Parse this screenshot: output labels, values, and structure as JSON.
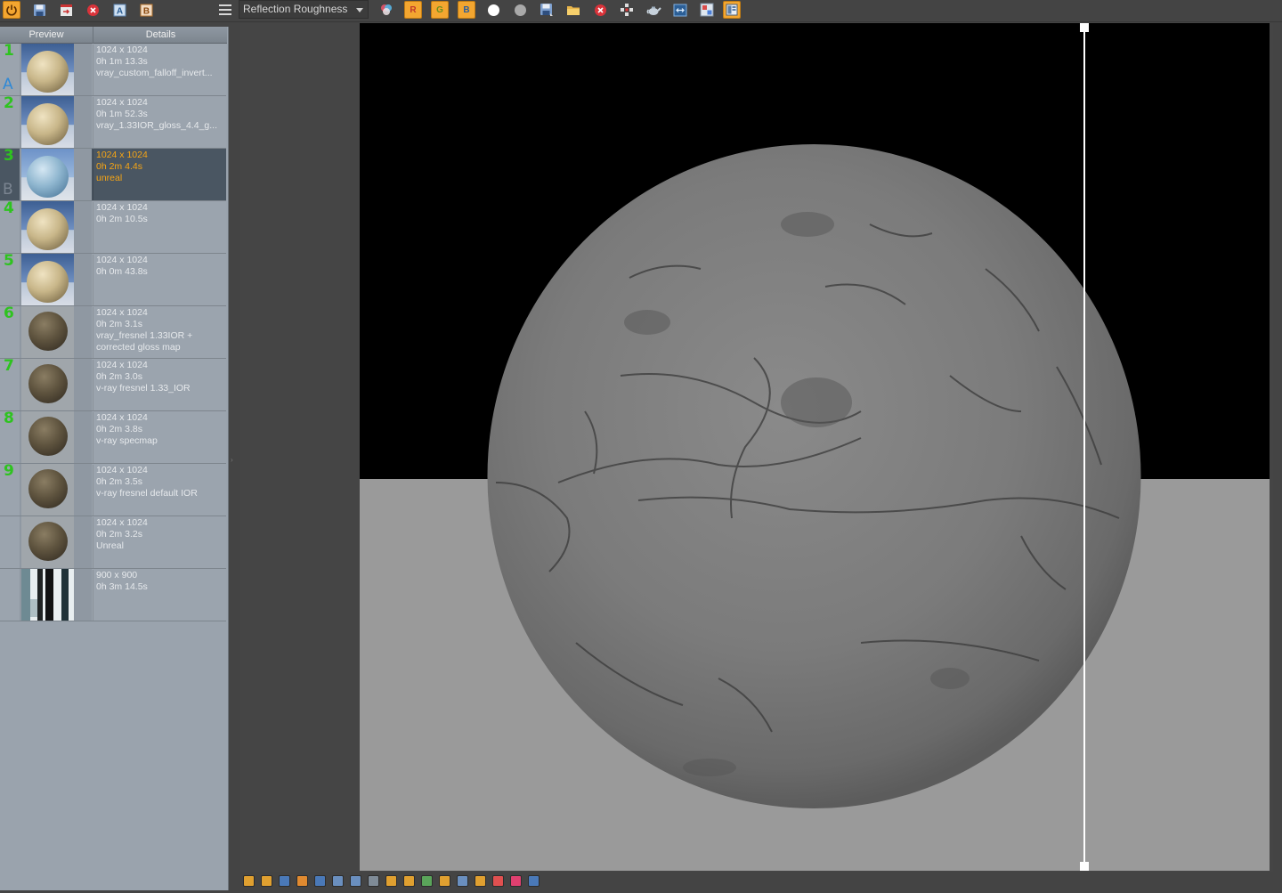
{
  "toolbar": {
    "channel_selected": "Reflection Roughness",
    "buttons": [
      {
        "name": "power-button",
        "icon": "power-icon",
        "color": "#f3a630"
      },
      {
        "name": "save-image-button",
        "icon": "floppy-icon"
      },
      {
        "name": "save-all-button",
        "icon": "save-all-icon"
      },
      {
        "name": "clear-button",
        "icon": "close-circle-icon",
        "color": "#d9333a"
      },
      {
        "name": "set-a-button",
        "icon": "a-letter-icon",
        "label": "A"
      },
      {
        "name": "set-b-button",
        "icon": "b-letter-icon",
        "label": "B"
      },
      {
        "name": "menu-button",
        "icon": "hamburger-icon"
      },
      {
        "name": "color-channels-button",
        "icon": "rgb-circles-icon"
      },
      {
        "name": "red-channel-button",
        "icon": "r-letter-icon",
        "label": "R",
        "color": "#f3a630"
      },
      {
        "name": "green-channel-button",
        "icon": "g-letter-icon",
        "label": "G",
        "color": "#f3a630"
      },
      {
        "name": "blue-channel-button",
        "icon": "b-letter-icon",
        "label": "B",
        "color": "#f3a630"
      },
      {
        "name": "white-alpha-button",
        "icon": "white-circle-icon"
      },
      {
        "name": "mono-button",
        "icon": "gray-circle-icon"
      },
      {
        "name": "save-button",
        "icon": "floppy-icon"
      },
      {
        "name": "open-button",
        "icon": "folder-icon"
      },
      {
        "name": "clear-image-button",
        "icon": "close-circle-icon"
      },
      {
        "name": "track-mouse-button",
        "icon": "crosshair-icon"
      },
      {
        "name": "render-button",
        "icon": "teapot-icon"
      },
      {
        "name": "region-render-button",
        "icon": "region-icon"
      },
      {
        "name": "compare-ab-button",
        "icon": "compare-icon"
      },
      {
        "name": "history-button",
        "icon": "history-icon",
        "color": "#f3a630"
      }
    ]
  },
  "history": {
    "header": {
      "preview": "Preview",
      "details": "Details"
    },
    "rows": [
      {
        "num": "1",
        "ab": "A",
        "line1": "1024 x 1024",
        "line2": "0h 1m 13.3s",
        "line3": "vray_custom_falloff_invert...",
        "line4": "",
        "thumb": "sand",
        "selected": false
      },
      {
        "num": "2",
        "ab": "",
        "line1": "1024 x 1024",
        "line2": "0h 1m 52.3s",
        "line3": "vray_1.33IOR_gloss_4.4_g...",
        "line4": "",
        "thumb": "sand",
        "selected": false
      },
      {
        "num": "3",
        "ab": "B",
        "line1": "1024 x 1024",
        "line2": "0h 2m 4.4s",
        "line3": "unreal",
        "line4": "",
        "thumb": "light",
        "selected": true
      },
      {
        "num": "4",
        "ab": "",
        "line1": "1024 x 1024",
        "line2": "0h 2m 10.5s",
        "line3": "",
        "line4": "",
        "thumb": "sand",
        "selected": false
      },
      {
        "num": "5",
        "ab": "",
        "line1": "1024 x 1024",
        "line2": "0h 0m 43.8s",
        "line3": "",
        "line4": "",
        "thumb": "sand",
        "selected": false
      },
      {
        "num": "6",
        "ab": "",
        "line1": "1024 x 1024",
        "line2": "0h 2m 3.1s",
        "line3": "vray_fresnel 1.33IOR +",
        "line4": "corrected gloss map",
        "thumb": "dark",
        "selected": false
      },
      {
        "num": "7",
        "ab": "",
        "line1": "1024 x 1024",
        "line2": "0h 2m 3.0s",
        "line3": "v-ray fresnel 1.33_IOR",
        "line4": "",
        "thumb": "dark",
        "selected": false
      },
      {
        "num": "8",
        "ab": "",
        "line1": "1024 x 1024",
        "line2": "0h 2m 3.8s",
        "line3": "v-ray specmap",
        "line4": "",
        "thumb": "dark",
        "selected": false
      },
      {
        "num": "9",
        "ab": "",
        "line1": "1024 x 1024",
        "line2": "0h 2m 3.5s",
        "line3": "v-ray fresnel default IOR",
        "line4": "",
        "thumb": "dark",
        "selected": false
      },
      {
        "num": "",
        "ab": "",
        "line1": "1024 x 1024",
        "line2": "0h 2m 3.2s",
        "line3": "Unreal",
        "line4": "",
        "thumb": "dark",
        "selected": false
      },
      {
        "num": "",
        "ab": "",
        "line1": "900 x 900",
        "line2": "0h 3m 14.5s",
        "line3": "",
        "line4": "",
        "thumb": "window",
        "selected": false
      }
    ]
  },
  "viewport": {
    "compare_split": 0.667,
    "background_top": "#000000",
    "background_floor": "#9a9a9a",
    "sphere_color": "#7b7b7b"
  },
  "colors": {
    "accent_orange": "#f3a630",
    "number_green": "#2ec31f",
    "ab_blue": "#2f89d6",
    "selected_text": "#f7a514"
  },
  "bottombar": {
    "icons": [
      "window-icon",
      "history-icon",
      "info-icon",
      "color-corrections-icon",
      "hsl-icon",
      "levels-icon",
      "curve-icon",
      "exposure-icon",
      "lut-icon",
      "lens-effects-icon",
      "bloom-icon",
      "display-icon",
      "stereo-icon",
      "ocio-icon",
      "fit-icon",
      "split-icon",
      "region-icon"
    ]
  }
}
